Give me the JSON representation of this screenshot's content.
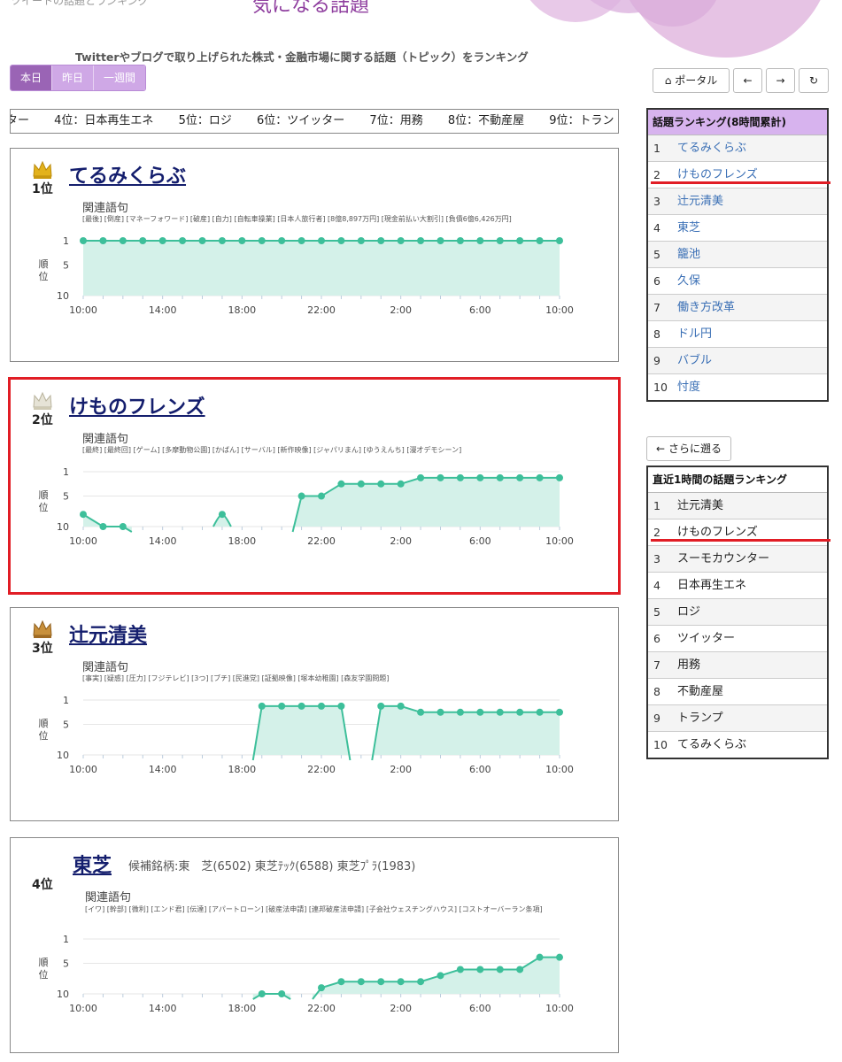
{
  "header": {
    "site_sub": "ツイートの話題とランキング",
    "title": "気になる話題",
    "description": "Twitterやブログで取り上げられた株式・金融市場に関する話題（トピック）をランキング"
  },
  "period_tabs": [
    "本日",
    "昨日",
    "一週間"
  ],
  "ticker": [
    "ンター",
    "4位：日本再生エネ",
    "5位：ロジ",
    "6位：ツイッター",
    "7位：用務",
    "8位：不動産屋",
    "9位：トラン"
  ],
  "nav": {
    "portal": "ポータル",
    "back": "さらに遡る"
  },
  "rank_labels": [
    "1位",
    "2位",
    "3位",
    "4位"
  ],
  "chart_common": {
    "kw_header": "関連語句",
    "ylabel_top": "順",
    "ylabel_bottom": "位",
    "yticks": [
      "1",
      "5",
      "10"
    ],
    "xticks": [
      "10:00",
      "14:00",
      "18:00",
      "22:00",
      "2:00",
      "6:00",
      "10:00"
    ]
  },
  "topics": [
    {
      "title": "てるみくらぶ",
      "keywords": "[最後] [倒産] [マネーフォワード] [破産] [自力] [自転車操業] [日本人旅行者] [8億8,897万円] [現金前払い大割引] [負債6億6,426万円]"
    },
    {
      "title": "けものフレンズ",
      "keywords": "[最終] [最終回] [ゲーム] [多摩動物公園] [かばん] [サーバル] [新作映像] [ジャパリまん] [ゆうえんち] [漫才デモシーン]"
    },
    {
      "title": "辻元清美",
      "keywords": "[事実] [疑惑] [圧力] [フジテレビ] [3つ] [ブチ] [民進党] [証拠映像] [塚本幼稚園] [森友学園問題]"
    },
    {
      "title": "東芝",
      "stock_info": "候補銘柄:東　芝(6502)  東芝ﾃｯｸ(6588)  東芝ﾌﾟﾗ(1983)",
      "keywords": "[イワ] [幹部] [微利] [エンド君] [伝達] [アパートローン] [破産法申請] [連邦破産法申請] [子会社ウェスチングハウス] [コストオーバーラン条項]"
    }
  ],
  "chart_data": [
    {
      "type": "area",
      "title": "てるみくらぶ",
      "ylabel": "順位",
      "y_reversed": true,
      "ylim": [
        1,
        10
      ],
      "x": [
        "10:00",
        "11:00",
        "12:00",
        "13:00",
        "14:00",
        "15:00",
        "16:00",
        "17:00",
        "18:00",
        "19:00",
        "20:00",
        "21:00",
        "22:00",
        "23:00",
        "0:00",
        "1:00",
        "2:00",
        "3:00",
        "4:00",
        "5:00",
        "6:00",
        "7:00",
        "8:00",
        "9:00",
        "10:00"
      ],
      "values": [
        1,
        1,
        1,
        1,
        1,
        1,
        1,
        1,
        1,
        1,
        1,
        1,
        1,
        1,
        1,
        1,
        1,
        1,
        1,
        1,
        1,
        1,
        1,
        1,
        1
      ]
    },
    {
      "type": "area",
      "title": "けものフレンズ",
      "ylabel": "順位",
      "y_reversed": true,
      "ylim": [
        1,
        10
      ],
      "x": [
        "10:00",
        "11:00",
        "12:00",
        "13:00",
        "14:00",
        "15:00",
        "16:00",
        "17:00",
        "18:00",
        "19:00",
        "20:00",
        "21:00",
        "22:00",
        "23:00",
        "0:00",
        "1:00",
        "2:00",
        "3:00",
        "4:00",
        "5:00",
        "6:00",
        "7:00",
        "8:00",
        "9:00",
        "10:00"
      ],
      "values": [
        8,
        10,
        10,
        null,
        null,
        null,
        null,
        8,
        null,
        null,
        null,
        5,
        5,
        3,
        3,
        3,
        3,
        2,
        2,
        2,
        2,
        2,
        2,
        2,
        2
      ]
    },
    {
      "type": "area",
      "title": "辻元清美",
      "ylabel": "順位",
      "y_reversed": true,
      "ylim": [
        1,
        10
      ],
      "x": [
        "10:00",
        "11:00",
        "12:00",
        "13:00",
        "14:00",
        "15:00",
        "16:00",
        "17:00",
        "18:00",
        "19:00",
        "20:00",
        "21:00",
        "22:00",
        "23:00",
        "0:00",
        "1:00",
        "2:00",
        "3:00",
        "4:00",
        "5:00",
        "6:00",
        "7:00",
        "8:00",
        "9:00",
        "10:00"
      ],
      "values": [
        null,
        null,
        null,
        null,
        null,
        null,
        null,
        null,
        null,
        2,
        2,
        2,
        2,
        2,
        null,
        2,
        2,
        3,
        3,
        3,
        3,
        3,
        3,
        3,
        3
      ]
    },
    {
      "type": "area",
      "title": "東芝",
      "ylabel": "順位",
      "y_reversed": true,
      "ylim": [
        1,
        10
      ],
      "x": [
        "10:00",
        "11:00",
        "12:00",
        "13:00",
        "14:00",
        "15:00",
        "16:00",
        "17:00",
        "18:00",
        "19:00",
        "20:00",
        "21:00",
        "22:00",
        "23:00",
        "0:00",
        "1:00",
        "2:00",
        "3:00",
        "4:00",
        "5:00",
        "6:00",
        "7:00",
        "8:00",
        "9:00",
        "10:00"
      ],
      "values": [
        null,
        null,
        null,
        null,
        null,
        null,
        null,
        null,
        null,
        10,
        10,
        null,
        9,
        8,
        8,
        8,
        8,
        8,
        7,
        6,
        6,
        6,
        6,
        4,
        4
      ]
    }
  ],
  "ranking_8h": {
    "title": "話題ランキング(8時間累計)",
    "items": [
      "てるみくらぶ",
      "けものフレンズ",
      "辻元清美",
      "東芝",
      "籠池",
      "久保",
      "働き方改革",
      "ドル円",
      "バブル",
      "忖度"
    ]
  },
  "ranking_1h": {
    "title": "直近1時間の話題ランキング",
    "items": [
      "辻元清美",
      "けものフレンズ",
      "スーモカウンター",
      "日本再生エネ",
      "ロジ",
      "ツイッター",
      "用務",
      "不動産屋",
      "トランプ",
      "てるみくらぶ"
    ]
  },
  "colors": {
    "accent": "#9a64b5",
    "chart_line": "#3dbf9a",
    "chart_fill": "#d4f1e9",
    "highlight": "#e11d25"
  }
}
